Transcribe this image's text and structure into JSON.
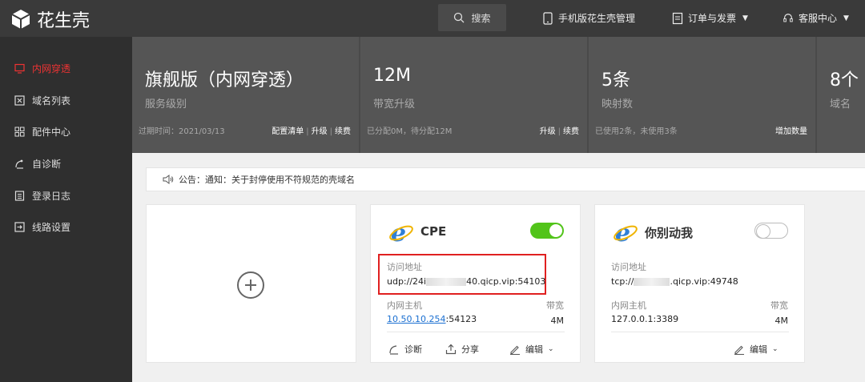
{
  "header": {
    "logo_text": "花生壳",
    "search_label": "搜索",
    "mobile_label": "手机版花生壳管理",
    "orders_label": "订单与发票",
    "support_label": "客服中心"
  },
  "sidebar": {
    "items": [
      {
        "label": "内网穿透",
        "icon": "monitor-icon",
        "active": true
      },
      {
        "label": "域名列表",
        "icon": "domain-icon",
        "active": false
      },
      {
        "label": "配件中心",
        "icon": "grid-icon",
        "active": false
      },
      {
        "label": "自诊断",
        "icon": "diagnose-icon",
        "active": false
      },
      {
        "label": "登录日志",
        "icon": "log-icon",
        "active": false
      },
      {
        "label": "线路设置",
        "icon": "route-icon",
        "active": false
      }
    ]
  },
  "stats": [
    {
      "big": "旗舰版（内网穿透）",
      "sub": "服务级别",
      "foot": "过期时间：2021/03/13",
      "links": [
        "配置清单",
        "升级",
        "续费"
      ]
    },
    {
      "big": "12M",
      "sub": "带宽升级",
      "foot": "已分配0M，待分配12M",
      "links": [
        "升级",
        "续费"
      ]
    },
    {
      "big": "5条",
      "sub": "映射数",
      "foot": "已使用2条，未使用3条",
      "links": [
        "增加数量"
      ]
    },
    {
      "big": "8个",
      "sub": "域名",
      "foot": "",
      "links": []
    }
  ],
  "notice": {
    "text": "公告：通知：关于封停使用不符规范的壳域名"
  },
  "cards": [
    {
      "title": "CPE",
      "enabled": true,
      "access_label": "访问地址",
      "access_prefix": "udp://24i",
      "access_suffix": "40.qicp.vip:54103",
      "host_label": "内网主机",
      "host_value": "10.50.10.254",
      "host_port": ":54123",
      "bw_label": "带宽",
      "bw_value": "4M",
      "actions": {
        "diagnose": "诊断",
        "share": "分享",
        "edit": "编辑"
      }
    },
    {
      "title": "你别动我",
      "enabled": false,
      "access_label": "访问地址",
      "access_prefix": "tcp://",
      "access_suffix": ".qicp.vip:49748",
      "host_label": "内网主机",
      "host_value": "127.0.0.1:3389",
      "bw_label": "带宽",
      "bw_value": "4M",
      "actions": {
        "edit": "编辑"
      }
    }
  ],
  "colors": {
    "accent_red": "#e33333",
    "toggle_on": "#52c41a",
    "link_blue": "#1a6fd1"
  }
}
